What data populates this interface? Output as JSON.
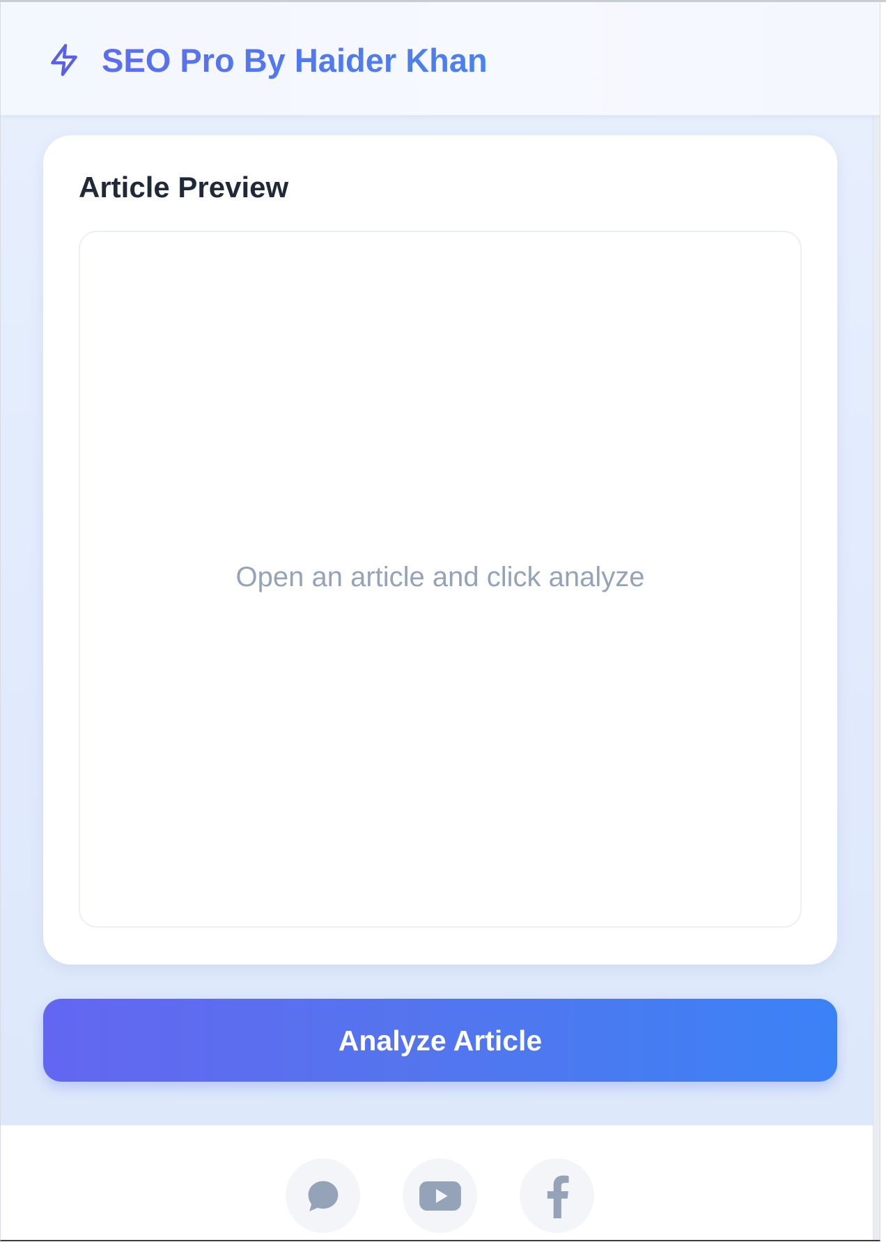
{
  "header": {
    "title": "SEO Pro By Haider Khan",
    "icon": "lightning-bolt-icon"
  },
  "preview": {
    "title": "Article Preview",
    "placeholder": "Open an article and click analyze"
  },
  "actions": {
    "analyze_label": "Analyze Article"
  },
  "footer": {
    "social_links": [
      {
        "icon": "chat-bubble-icon"
      },
      {
        "icon": "youtube-icon"
      },
      {
        "icon": "facebook-icon"
      }
    ]
  },
  "colors": {
    "accent_start": "#6366f1",
    "accent_end": "#3b82f6",
    "text_dark": "#1f2937",
    "text_muted": "#94a3b8",
    "icon_muted": "#94a3b8"
  }
}
